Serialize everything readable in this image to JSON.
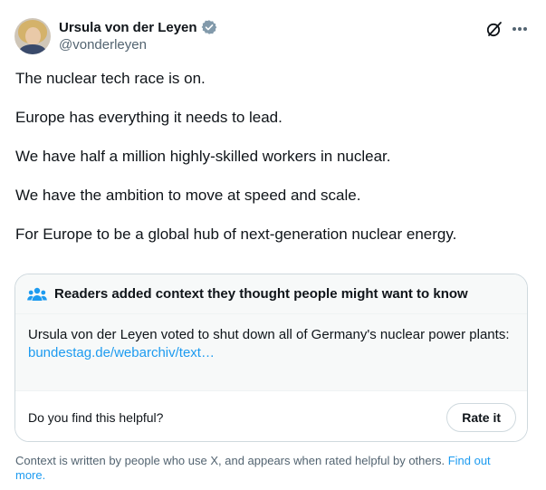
{
  "author": {
    "display_name": "Ursula von der Leyen",
    "handle": "@vonderleyen",
    "verified": true,
    "verified_color": "#829aab"
  },
  "header_icons": {
    "grok": "grok-icon",
    "more": "more-icon"
  },
  "post": {
    "paragraphs": [
      "The nuclear tech race is on.",
      "Europe has everything it needs to lead.",
      "We have half a million highly-skilled workers in nuclear.",
      "We have the ambition to move at speed and scale.",
      "For Europe to be a global hub of next-generation nuclear energy."
    ]
  },
  "community_note": {
    "title": "Readers added context they thought people might want to know",
    "text": "Ursula von der Leyen voted to shut down all of Germany's nuclear power plants:",
    "link_text": "bundestag.de/webarchiv/text…",
    "helpful_question": "Do you find this helpful?",
    "rate_label": "Rate it",
    "accent_color": "#1d9bf0"
  },
  "disclaimer": {
    "text": "Context is written by people who use X, and appears when rated helpful by others.",
    "link_text": "Find out more."
  }
}
